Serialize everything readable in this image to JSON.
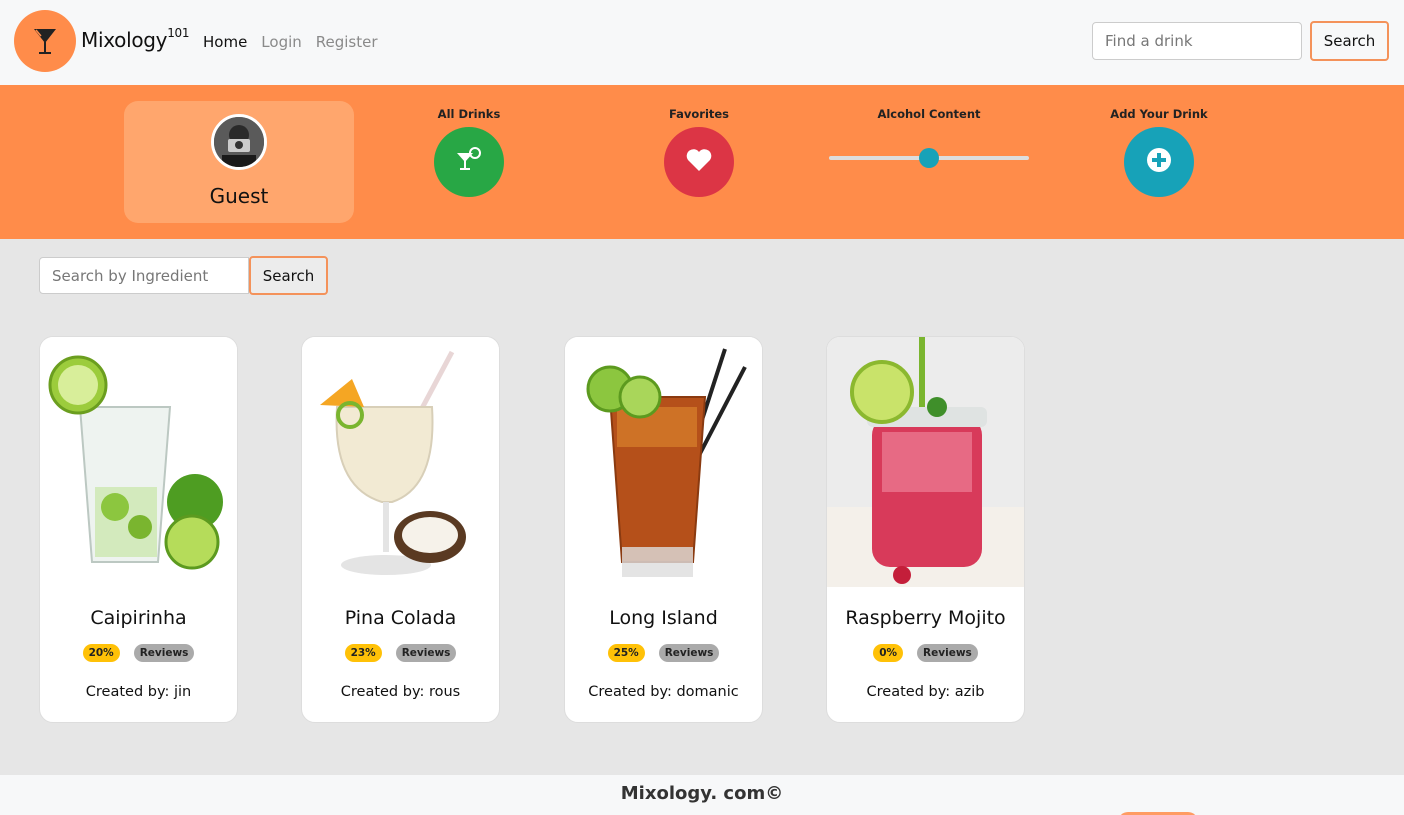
{
  "nav": {
    "brand": "Mixology",
    "brand_sup": "101",
    "links": [
      "Home",
      "Login",
      "Register"
    ],
    "search_placeholder": "Find a drink",
    "search_button": "Search"
  },
  "profile": {
    "name": "Guest"
  },
  "actions": {
    "all_drinks": "All Drinks",
    "favorites": "Favorites",
    "alcohol_content": "Alcohol Content",
    "add_drink": "Add Your Drink",
    "alcohol_slider_value": 0.5
  },
  "ingredient_search": {
    "placeholder": "Search by Ingredient",
    "button": "Search"
  },
  "drinks": [
    {
      "name": "Caipirinha",
      "abv": "20%",
      "reviews": "Reviews",
      "creator": "Created by: jin"
    },
    {
      "name": "Pina Colada",
      "abv": "23%",
      "reviews": "Reviews",
      "creator": "Created by: rous"
    },
    {
      "name": "Long Island",
      "abv": "25%",
      "reviews": "Reviews",
      "creator": "Created by: domanic"
    },
    {
      "name": "Raspberry Mojito",
      "abv": "0%",
      "reviews": "Reviews",
      "creator": "Created by: azib"
    }
  ],
  "footer": {
    "text": "Mixology. com©"
  },
  "colors": {
    "accent": "#ff8c4a",
    "all_drinks": "#28a745",
    "favorites": "#dc3545",
    "add_drink": "#17a2b8",
    "abv_badge": "#ffc107",
    "reviews_badge": "#aaaaaa"
  }
}
